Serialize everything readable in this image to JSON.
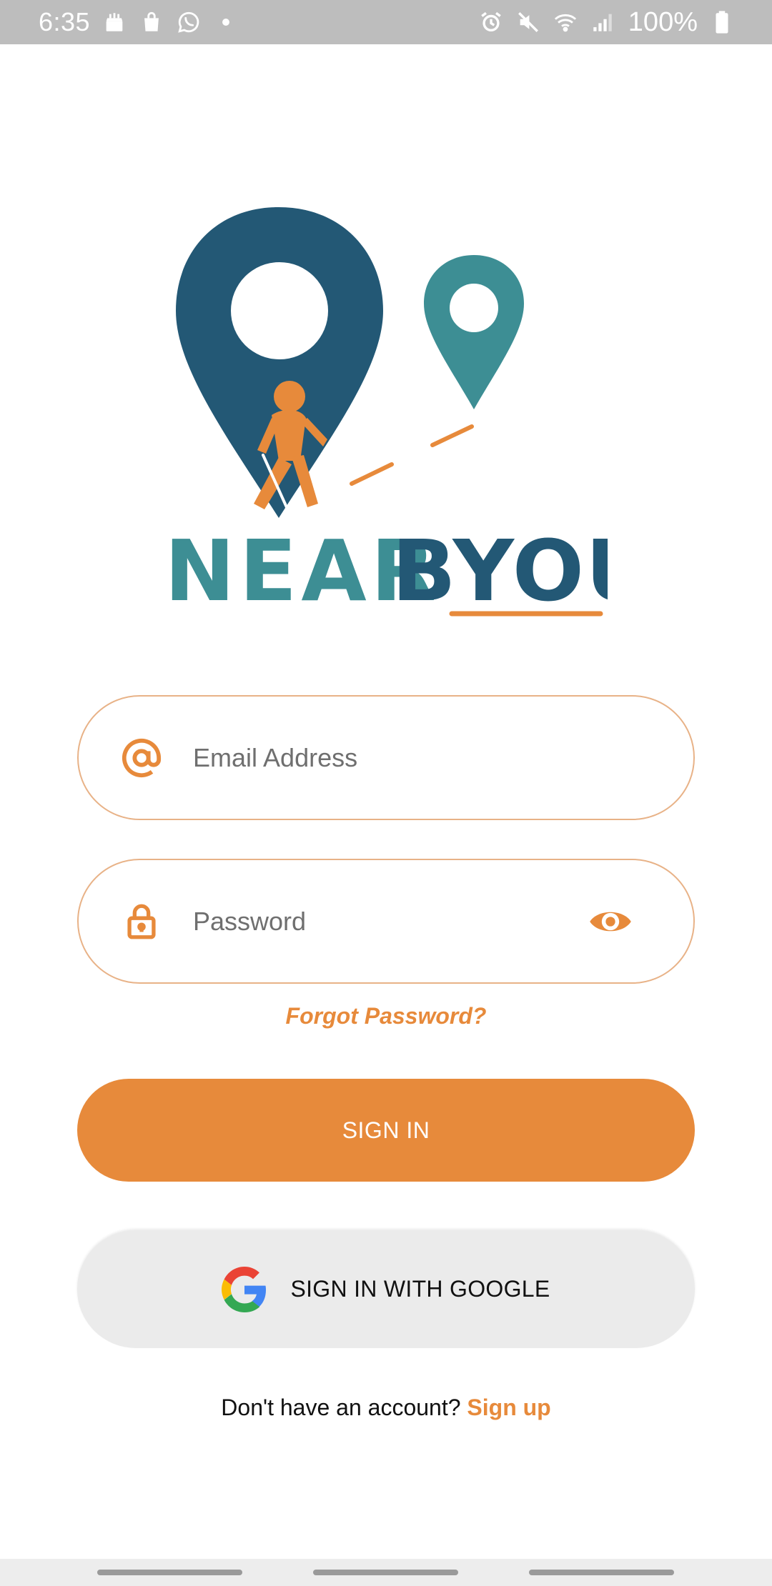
{
  "status_bar": {
    "time": "6:35",
    "battery": "100%",
    "left_icons": [
      "cake-icon",
      "shopping-bag-icon",
      "whatsapp-icon",
      "dot-icon"
    ],
    "right_icons": [
      "alarm-icon",
      "mute-icon",
      "wifi-icon",
      "signal-icon",
      "battery-icon"
    ]
  },
  "logo": {
    "word_near": "NEAR",
    "word_byou": "BYOU",
    "colors": {
      "dark_blue": "#235875",
      "teal": "#3d8e94",
      "orange": "#e78a3b"
    }
  },
  "login_form": {
    "email": {
      "placeholder": "Email Address",
      "value": "",
      "icon": "at-icon"
    },
    "password": {
      "placeholder": "Password",
      "value": "",
      "icon": "lock-icon",
      "toggle_icon": "eye-icon"
    },
    "forgot_password": "Forgot Password?",
    "sign_in": "SIGN IN",
    "google_sign_in": "SIGN IN WITH GOOGLE",
    "signup_prompt": "Don't have an account?",
    "signup_link": "Sign up"
  },
  "theme": {
    "accent": "#e78a3b",
    "field_border": "#e8b287",
    "google_button_bg": "#ebebeb"
  }
}
